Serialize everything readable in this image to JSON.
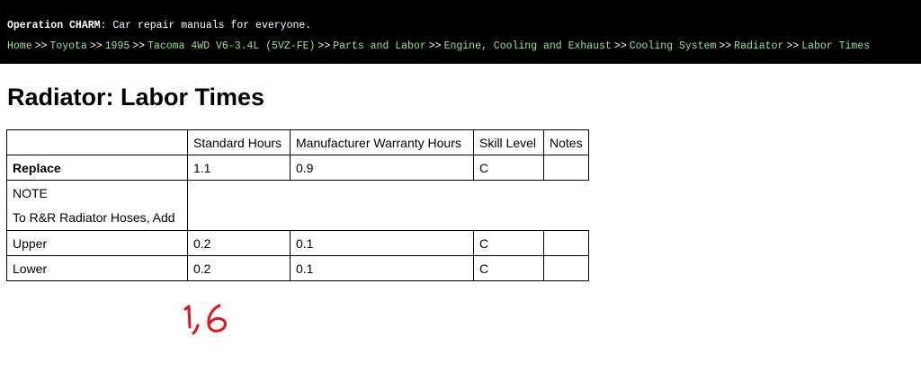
{
  "header": {
    "brand": "Operation CHARM",
    "tagline": ": Car repair manuals for everyone.",
    "breadcrumbs": [
      "Home",
      "Toyota",
      "1995",
      "Tacoma 4WD V6-3.4L (5VZ-FE)",
      "Parts and Labor",
      "Engine, Cooling and Exhaust",
      "Cooling System",
      "Radiator",
      "Labor Times"
    ],
    "separator": ">>"
  },
  "page": {
    "title": "Radiator: Labor Times"
  },
  "table": {
    "columns": [
      "",
      "Standard Hours",
      "Manufacturer Warranty Hours",
      "Skill Level",
      "Notes"
    ],
    "replace_row": {
      "label": "Replace",
      "standard": "1.1",
      "warranty": "0.9",
      "skill": "C",
      "notes": ""
    },
    "note_label": "NOTE",
    "note_text": "To R&R Radiator Hoses, Add",
    "rows": [
      {
        "label": "Upper",
        "standard": "0.2",
        "warranty": "0.1",
        "skill": "C",
        "notes": ""
      },
      {
        "label": "Lower",
        "standard": "0.2",
        "warranty": "0.1",
        "skill": "C",
        "notes": ""
      }
    ]
  },
  "annotation": {
    "handwritten": "1,6",
    "color": "#e0141e"
  },
  "colors": {
    "link": "#9be39b",
    "header_bg": "#000000"
  }
}
